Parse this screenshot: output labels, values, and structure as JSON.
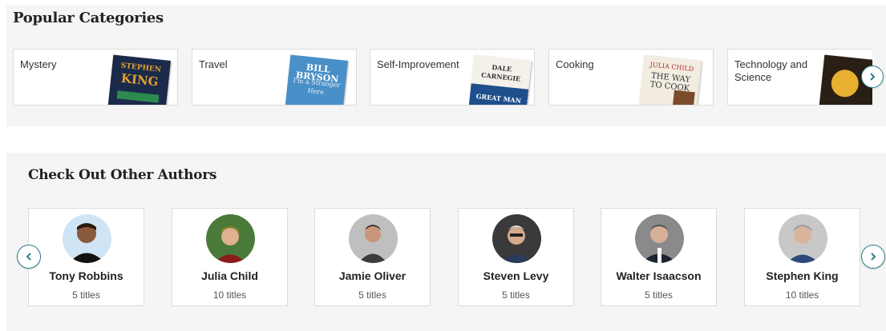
{
  "categories": {
    "heading": "Popular Categories",
    "items": [
      {
        "label": "Mystery",
        "cover_line1": "STEPHEN",
        "cover_line2": "KING"
      },
      {
        "label": "Travel",
        "cover_line1": "BILL BRYSON",
        "cover_line2": "I'm a Stranger Here"
      },
      {
        "label": "Self-Improvement",
        "cover_line1": "DALE CARNEGIE",
        "cover_line2": "GREAT MAN"
      },
      {
        "label": "Cooking",
        "cover_line1": "JULIA CHILD",
        "cover_line2": "THE WAY TO COOK"
      },
      {
        "label": "Technology and Science",
        "cover_line1": "",
        "cover_line2": ""
      }
    ]
  },
  "authors": {
    "heading": "Check Out Other Authors",
    "items": [
      {
        "name": "Tony Robbins",
        "count": "5 titles"
      },
      {
        "name": "Julia Child",
        "count": "10 titles"
      },
      {
        "name": "Jamie Oliver",
        "count": "5 titles"
      },
      {
        "name": "Steven Levy",
        "count": "5 titles"
      },
      {
        "name": "Walter Isaacson",
        "count": "5 titles"
      },
      {
        "name": "Stephen King",
        "count": "10 titles"
      }
    ]
  },
  "colors": {
    "accent": "#2b7d8c",
    "section_bg": "#f5f5f5",
    "card_border": "#dcdcdc"
  },
  "icons": {
    "next": "chevron-right-icon",
    "prev": "chevron-left-icon"
  }
}
